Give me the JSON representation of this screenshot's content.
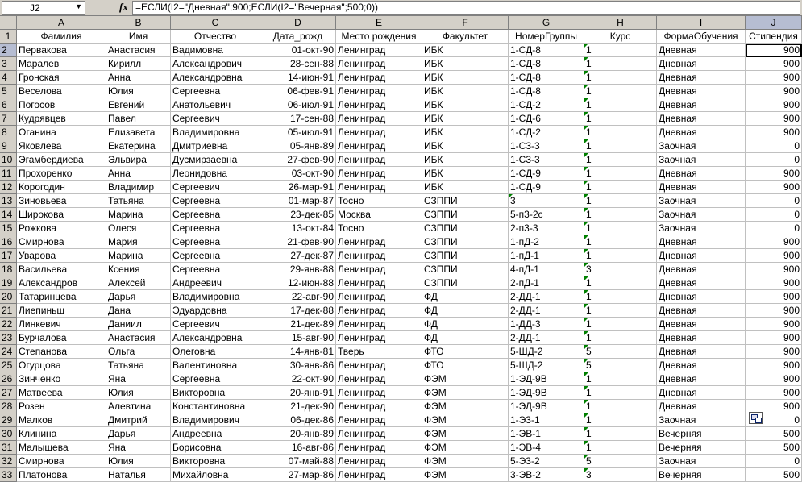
{
  "namebox": "J2",
  "formula": "=ЕСЛИ(I2=\"Дневная\";900;ЕСЛИ(I2=\"Вечерная\";500;0))",
  "fx": "fx",
  "columns": [
    "A",
    "B",
    "C",
    "D",
    "E",
    "F",
    "G",
    "H",
    "I",
    "J"
  ],
  "headers": [
    "Фамилия",
    "Имя",
    "Отчество",
    "Дата_рожд",
    "Место рождения",
    "Факультет",
    "НомерГруппы",
    "Курс",
    "ФормаОбучения",
    "Стипендия"
  ],
  "rows": [
    [
      "Первакова",
      "Анастасия",
      "Вадимовна",
      "01-окт-90",
      "Ленинград",
      "ИБК",
      "1-СД-8",
      "1",
      "Дневная",
      "900"
    ],
    [
      "Маралев",
      "Кирилл",
      "Александрович",
      "28-сен-88",
      "Ленинград",
      "ИБК",
      "1-СД-8",
      "1",
      "Дневная",
      "900"
    ],
    [
      "Гронская",
      "Анна",
      "Александровна",
      "14-июн-91",
      "Ленинград",
      "ИБК",
      "1-СД-8",
      "1",
      "Дневная",
      "900"
    ],
    [
      "Веселова",
      "Юлия",
      "Сергеевна",
      "06-фев-91",
      "Ленинград",
      "ИБК",
      "1-СД-8",
      "1",
      "Дневная",
      "900"
    ],
    [
      "Погосов",
      "Евгений",
      "Анатольевич",
      "06-июл-91",
      "Ленинград",
      "ИБК",
      "1-СД-2",
      "1",
      "Дневная",
      "900"
    ],
    [
      "Кудрявцев",
      "Павел",
      "Сергеевич",
      "17-сен-88",
      "Ленинград",
      "ИБК",
      "1-СД-6",
      "1",
      "Дневная",
      "900"
    ],
    [
      "Оганина",
      "Елизавета",
      "Владимировна",
      "05-июл-91",
      "Ленинград",
      "ИБК",
      "1-СД-2",
      "1",
      "Дневная",
      "900"
    ],
    [
      "Яковлева",
      "Екатерина",
      "Дмитриевна",
      "05-янв-89",
      "Ленинград",
      "ИБК",
      "1-С3-3",
      "1",
      "Заочная",
      "0"
    ],
    [
      "Эгамбердиева",
      "Эльвира",
      "Дусмирзаевна",
      "27-фев-90",
      "Ленинград",
      "ИБК",
      "1-С3-3",
      "1",
      "Заочная",
      "0"
    ],
    [
      "Прохоренко",
      "Анна",
      "Леонидовна",
      "03-окт-90",
      "Ленинград",
      "ИБК",
      "1-СД-9",
      "1",
      "Дневная",
      "900"
    ],
    [
      "Корогодин",
      "Владимир",
      "Сергеевич",
      "26-мар-91",
      "Ленинград",
      "ИБК",
      "1-СД-9",
      "1",
      "Дневная",
      "900"
    ],
    [
      "Зиновьева",
      "Татьяна",
      "Сергеевна",
      "01-мар-87",
      "Тосно",
      "СЗППИ",
      "3",
      "1",
      "Заочная",
      "0"
    ],
    [
      "Широкова",
      "Марина",
      "Сергеевна",
      "23-дек-85",
      "Москва",
      "СЗППИ",
      "5-п3-2с",
      "1",
      "Заочная",
      "0"
    ],
    [
      "Рожкова",
      "Олеся",
      "Сергеевна",
      "13-окт-84",
      "Тосно",
      "СЗППИ",
      "2-п3-3",
      "1",
      "Заочная",
      "0"
    ],
    [
      "Смирнова",
      "Мария",
      "Сергеевна",
      "21-фев-90",
      "Ленинград",
      "СЗППИ",
      "1-пД-2",
      "1",
      "Дневная",
      "900"
    ],
    [
      "Уварова",
      "Марина",
      "Сергеевна",
      "27-дек-87",
      "Ленинград",
      "СЗППИ",
      "1-пД-1",
      "1",
      "Дневная",
      "900"
    ],
    [
      "Васильева",
      "Ксения",
      "Сергеевна",
      "29-янв-88",
      "Ленинград",
      "СЗППИ",
      "4-пД-1",
      "3",
      "Дневная",
      "900"
    ],
    [
      "Александров",
      "Алексей",
      "Андреевич",
      "12-июн-88",
      "Ленинград",
      "СЗППИ",
      "2-пД-1",
      "1",
      "Дневная",
      "900"
    ],
    [
      "Татаринцева",
      "Дарья",
      "Владимировна",
      "22-авг-90",
      "Ленинград",
      "ФД",
      "2-ДД-1",
      "1",
      "Дневная",
      "900"
    ],
    [
      "Лиепиньш",
      "Дана",
      "Эдуардовна",
      "17-дек-88",
      "Ленинград",
      "ФД",
      "2-ДД-1",
      "1",
      "Дневная",
      "900"
    ],
    [
      "Линкевич",
      "Даниил",
      "Сергеевич",
      "21-дек-89",
      "Ленинград",
      "ФД",
      "1-ДД-3",
      "1",
      "Дневная",
      "900"
    ],
    [
      "Бурчалова",
      "Анастасия",
      "Александровна",
      "15-авг-90",
      "Ленинград",
      "ФД",
      "2-ДД-1",
      "1",
      "Дневная",
      "900"
    ],
    [
      "Степанова",
      "Ольга",
      "Олеговна",
      "14-янв-81",
      "Тверь",
      "ФТО",
      "5-ШД-2",
      "5",
      "Дневная",
      "900"
    ],
    [
      "Огурцова",
      "Татьяна",
      "Валентиновна",
      "30-янв-86",
      "Ленинград",
      "ФТО",
      "5-ШД-2",
      "5",
      "Дневная",
      "900"
    ],
    [
      "Зинченко",
      "Яна",
      "Сергеевна",
      "22-окт-90",
      "Ленинград",
      "ФЭМ",
      "1-ЭД-9В",
      "1",
      "Дневная",
      "900"
    ],
    [
      "Матвеева",
      "Юлия",
      "Викторовна",
      "20-янв-91",
      "Ленинград",
      "ФЭМ",
      "1-ЭД-9В",
      "1",
      "Дневная",
      "900"
    ],
    [
      "Розен",
      "Алевтина",
      "Константиновна",
      "21-дек-90",
      "Ленинград",
      "ФЭМ",
      "1-ЭД-9В",
      "1",
      "Дневная",
      "900"
    ],
    [
      "Малков",
      "Дмитрий",
      "Владимирович",
      "06-дек-86",
      "Ленинград",
      "ФЭМ",
      "1-Э3-1",
      "1",
      "Заочная",
      "0"
    ],
    [
      "Клинина",
      "Дарья",
      "Андреевна",
      "20-янв-89",
      "Ленинград",
      "ФЭМ",
      "1-ЭВ-1",
      "1",
      "Вечерняя",
      "500"
    ],
    [
      "Малышева",
      "Яна",
      "Борисовна",
      "16-авг-86",
      "Ленинград",
      "ФЭМ",
      "1-ЭВ-4",
      "1",
      "Вечерняя",
      "500"
    ],
    [
      "Смирнова",
      "Юлия",
      "Викторовна",
      "07-май-88",
      "Ленинград",
      "ФЭМ",
      "5-Э3-2",
      "5",
      "Заочная",
      "0"
    ],
    [
      "Платонова",
      "Наталья",
      "Михайловна",
      "27-мар-86",
      "Ленинград",
      "ФЭМ",
      "3-ЭВ-2",
      "3",
      "Вечерняя",
      "500"
    ]
  ],
  "colors": {
    "header_bg": "#d4d0c8",
    "active_header_bg": "#b6bdd2",
    "gridline": "#c0c0c0",
    "error_indicator": "#008000"
  }
}
